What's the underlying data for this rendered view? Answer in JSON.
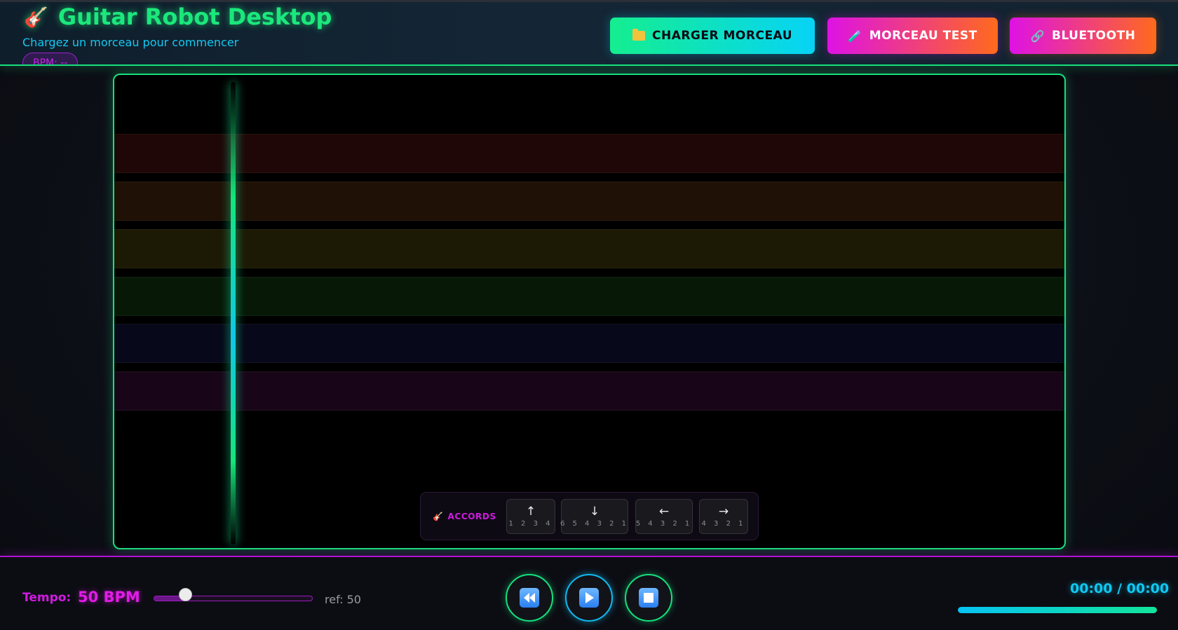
{
  "header": {
    "title": "Guitar Robot Desktop",
    "title_icon": "guitar-icon",
    "subtitle": "Chargez un morceau pour commencer",
    "bpm_badge": "BPM: --",
    "buttons": {
      "load": {
        "label": "CHARGER MORCEAU",
        "icon": "folder-icon"
      },
      "test": {
        "label": "MORCEAU TEST",
        "icon": "test-tube-icon"
      },
      "bluetooth": {
        "label": "BLUETOOTH",
        "icon": "link-icon"
      }
    }
  },
  "stage": {
    "strings": [
      {
        "color": "#3a0d0d"
      },
      {
        "color": "#3a1f0a"
      },
      {
        "color": "#34300a"
      },
      {
        "color": "#0e2c0e"
      },
      {
        "color": "#0d0f2e"
      },
      {
        "color": "#2c0b2c"
      }
    ],
    "chords": {
      "label": "ACCORDS",
      "icon": "guitar-icon",
      "keys": [
        {
          "arrow": "↑",
          "strings": "1 2 3 4"
        },
        {
          "arrow": "↓",
          "strings": "6 5 4 3 2 1"
        },
        {
          "arrow": "←",
          "strings": "5 4 3 2 1"
        },
        {
          "arrow": "→",
          "strings": "4 3 2 1"
        }
      ]
    }
  },
  "transport": {
    "tempo_label": "Tempo:",
    "tempo_value": "50 BPM",
    "tempo_slider_fraction": 0.2,
    "ref_text": "ref: 50",
    "controls": {
      "rewind": "rewind-icon",
      "play": "play-icon",
      "stop": "stop-icon"
    },
    "time": "00:00 / 00:00",
    "progress_fraction": 1.0
  },
  "colors": {
    "accent_green": "#17e07d",
    "accent_cyan": "#0fc8f2",
    "accent_magenta": "#d01ae0",
    "accent_orange": "#ff6a1c"
  }
}
